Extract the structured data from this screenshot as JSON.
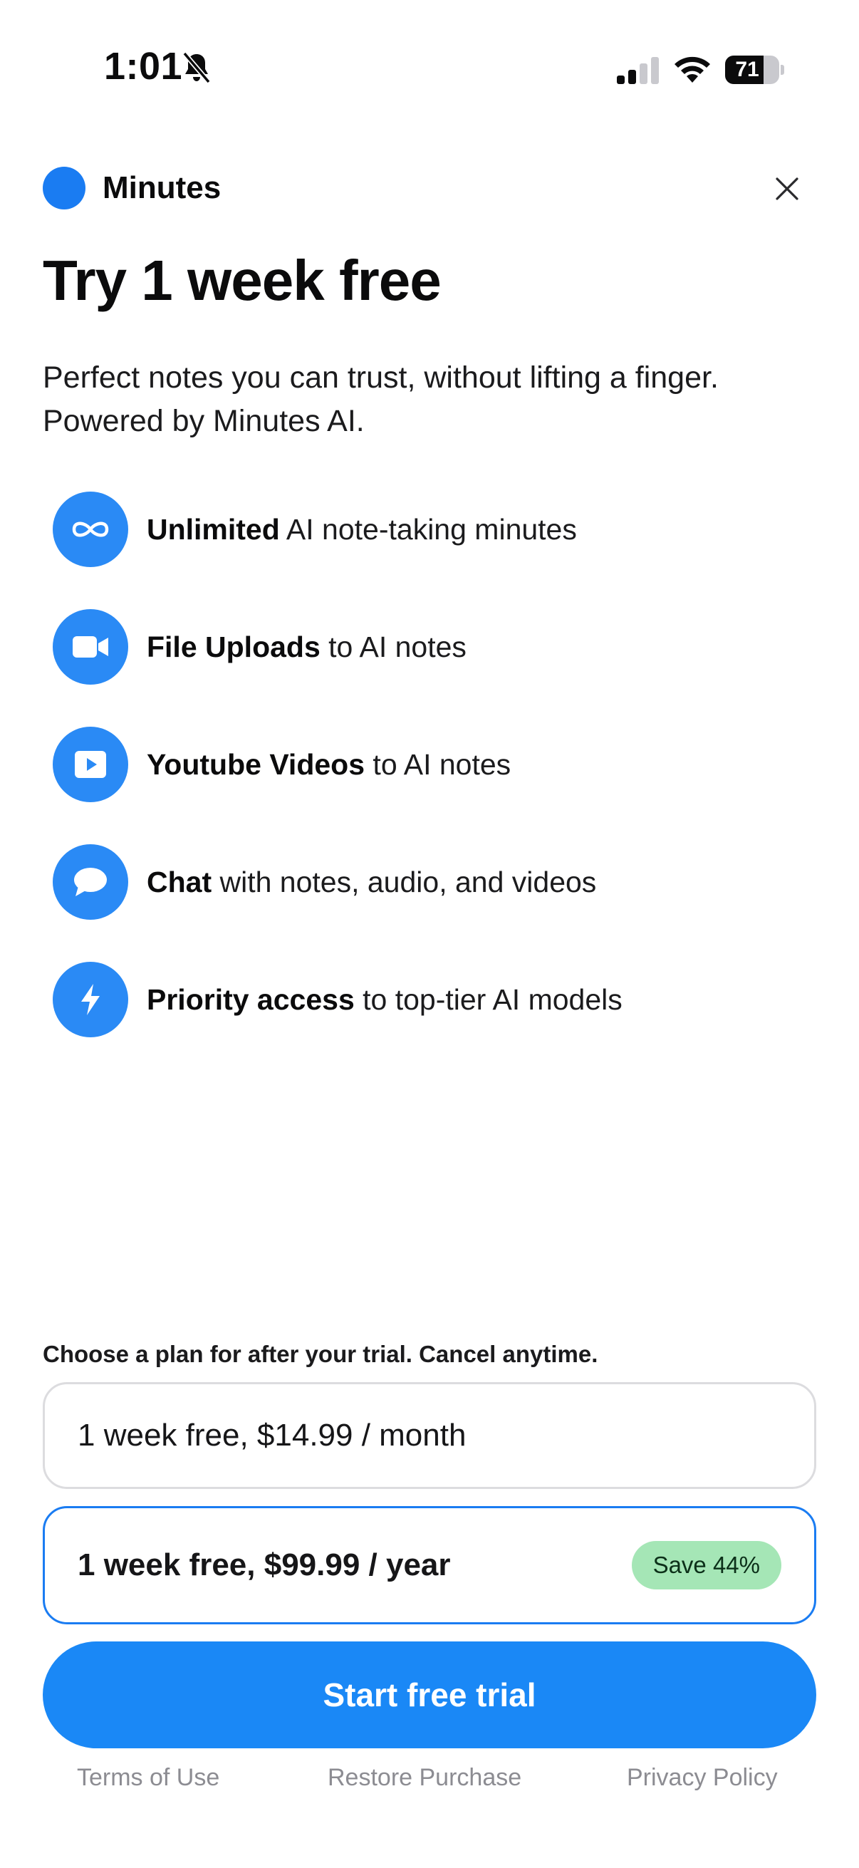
{
  "status_bar": {
    "time": "1:01",
    "battery": "71",
    "battery_level": 0.71,
    "icons": [
      "bell-slash-icon",
      "signal-icon",
      "wifi-icon",
      "battery-icon"
    ]
  },
  "header": {
    "app_name": "Minutes",
    "close_icon": "close-icon"
  },
  "headline": "Try 1 week free",
  "subheadline": "Perfect notes you can trust, without lifting a finger. Powered by Minutes AI.",
  "features": [
    {
      "bold": "Unlimited",
      "rest": " AI note-taking minutes",
      "icon": "infinity-icon"
    },
    {
      "bold": "File Uploads",
      "rest": " to AI notes",
      "icon": "video-camera-icon"
    },
    {
      "bold": "Youtube Videos",
      "rest": " to AI notes",
      "icon": "play-icon"
    },
    {
      "bold": "Chat",
      "rest": " with notes, audio, and videos",
      "icon": "chat-bubble-icon"
    },
    {
      "bold": "Priority access",
      "rest": " to top-tier AI models",
      "icon": "lightning-icon"
    }
  ],
  "plans": {
    "caption": "Choose a plan for after your trial. Cancel anytime.",
    "monthly": {
      "label": "1 week free, $14.99 / month"
    },
    "yearly": {
      "label": "1 week free, $99.99 / year",
      "badge": "Save 44%",
      "selected": true
    }
  },
  "cta": "Start free trial",
  "footer": {
    "terms": "Terms of Use",
    "restore": "Restore Purchase",
    "privacy": "Privacy Policy"
  },
  "colors": {
    "accent": "#1a88f6",
    "icon_bg": "#2a8af5",
    "badge_bg": "#a5e6b6",
    "footer_text": "#8c8c92"
  }
}
